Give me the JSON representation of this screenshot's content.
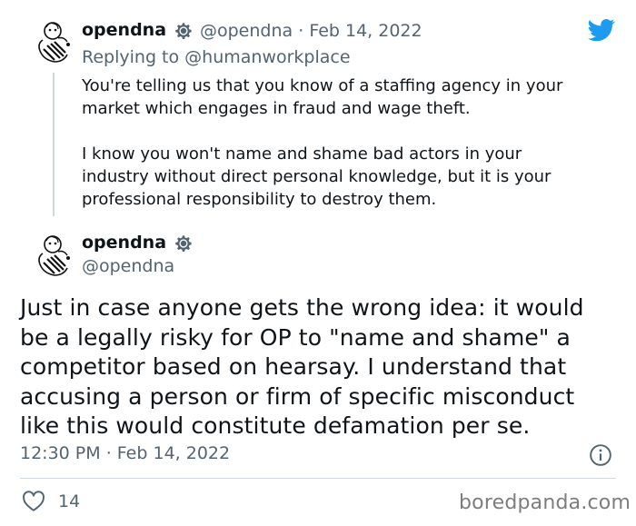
{
  "reply_tweet": {
    "author_name": "opendna",
    "author_handle": "@opendna",
    "separator": "·",
    "date": "Feb 14, 2022",
    "replying_to_label": "Replying to",
    "replying_to_handle": "@humanworkplace",
    "lines": [
      "You're telling us that you know of a staffing agency in your",
      "market which engages in fraud and wage theft.",
      "",
      "I know you won't name and shame bad actors in your",
      "industry without direct personal knowledge, but it is your",
      "professional responsibility to destroy them."
    ]
  },
  "main_tweet": {
    "author_name": "opendna",
    "author_handle": "@opendna",
    "lines": [
      "Just in case anyone gets the wrong idea: it would",
      "be a legally risky for OP to \"name and shame\" a",
      "competitor based on hearsay. I understand that",
      "accusing a person or firm of specific misconduct",
      "like this would constitute defamation per se."
    ],
    "time": "12:30 PM",
    "separator": "·",
    "date": "Feb 14, 2022",
    "likes": "14"
  },
  "icons": {
    "verified_style": "gear-icon",
    "brand": "twitter-bird-icon",
    "like": "heart-icon",
    "info": "info-icon"
  },
  "colors": {
    "twitter_blue": "#1d9bf0",
    "secondary_text": "#536471",
    "primary_text": "#0f1419",
    "divider": "#cfd9de"
  },
  "watermark": "boredpanda.com"
}
